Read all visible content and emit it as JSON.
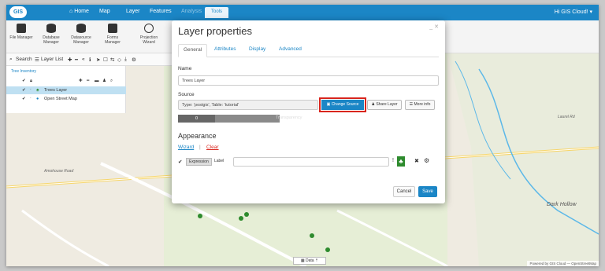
{
  "topbar": {
    "logo_text": "GIS",
    "nav": [
      {
        "label": "Home",
        "icon": "home-icon"
      },
      {
        "label": "Map"
      },
      {
        "label": "Layer"
      },
      {
        "label": "Features"
      },
      {
        "label": "Analysis"
      },
      {
        "label": "Tools"
      }
    ],
    "user_label": "Hi GIS Cloud! ▾"
  },
  "ribbon": {
    "buttons": [
      {
        "label": "File Manager",
        "icon": "file-manager-icon"
      },
      {
        "label": "Database Manager",
        "icon": "database-icon"
      },
      {
        "label": "Datasource Manager",
        "icon": "datasource-icon"
      },
      {
        "label": "Forms Manager",
        "icon": "forms-icon"
      },
      {
        "label": "Projection Wizard",
        "icon": "projection-icon"
      }
    ]
  },
  "layer_toolbar": {
    "search_label": "Search",
    "layer_list_label": "Layer List"
  },
  "layer_panel": {
    "group_name": "Tree Inventory",
    "layers": [
      {
        "name": "Trees Layer",
        "selected": true
      },
      {
        "name": "Open Street Map",
        "selected": false
      }
    ]
  },
  "dialog": {
    "title": "Layer properties",
    "tabs": [
      "General",
      "Attributes",
      "Display",
      "Advanced"
    ],
    "active_tab": "General",
    "name_label": "Name",
    "name_value": "Trees Layer",
    "source_label": "Source",
    "source_value": "Type: 'postgis', Table: 'tutorial'",
    "change_source_label": "Change Source",
    "share_layer_label": "Share Layer",
    "more_info_label": "More info",
    "opacity_value": "0",
    "transparency_label": "Transparency",
    "appearance_heading": "Appearance",
    "wizard_label": "Wizard",
    "separator": "|",
    "clear_label": "Clear",
    "expression_tag": "Expression",
    "expression_label": "Label",
    "cancel_label": "Cancel",
    "save_label": "Save"
  },
  "map": {
    "labels": [
      "Amohouse Road",
      "Dark Hollow",
      "Laurel Rd",
      "Powered by GIS Cloud — OpenStreetMap"
    ],
    "data_button": "Data"
  },
  "colors": {
    "brand": "#1b86c6",
    "highlight": "#d9251d",
    "save": "#1b86c6"
  }
}
